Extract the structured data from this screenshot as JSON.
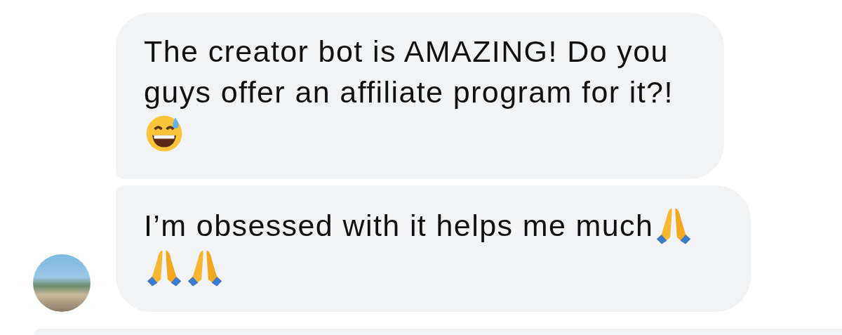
{
  "messages": [
    {
      "text": "The creator bot is AMAZING! Do you guys offer an affiliate program for it?!",
      "emoji": [
        {
          "kind": "sweat_smile"
        }
      ]
    },
    {
      "text": "I’m obsessed with it helps me much",
      "emoji": [
        {
          "kind": "folded_hands"
        },
        {
          "kind": "folded_hands"
        },
        {
          "kind": "folded_hands"
        }
      ]
    }
  ]
}
